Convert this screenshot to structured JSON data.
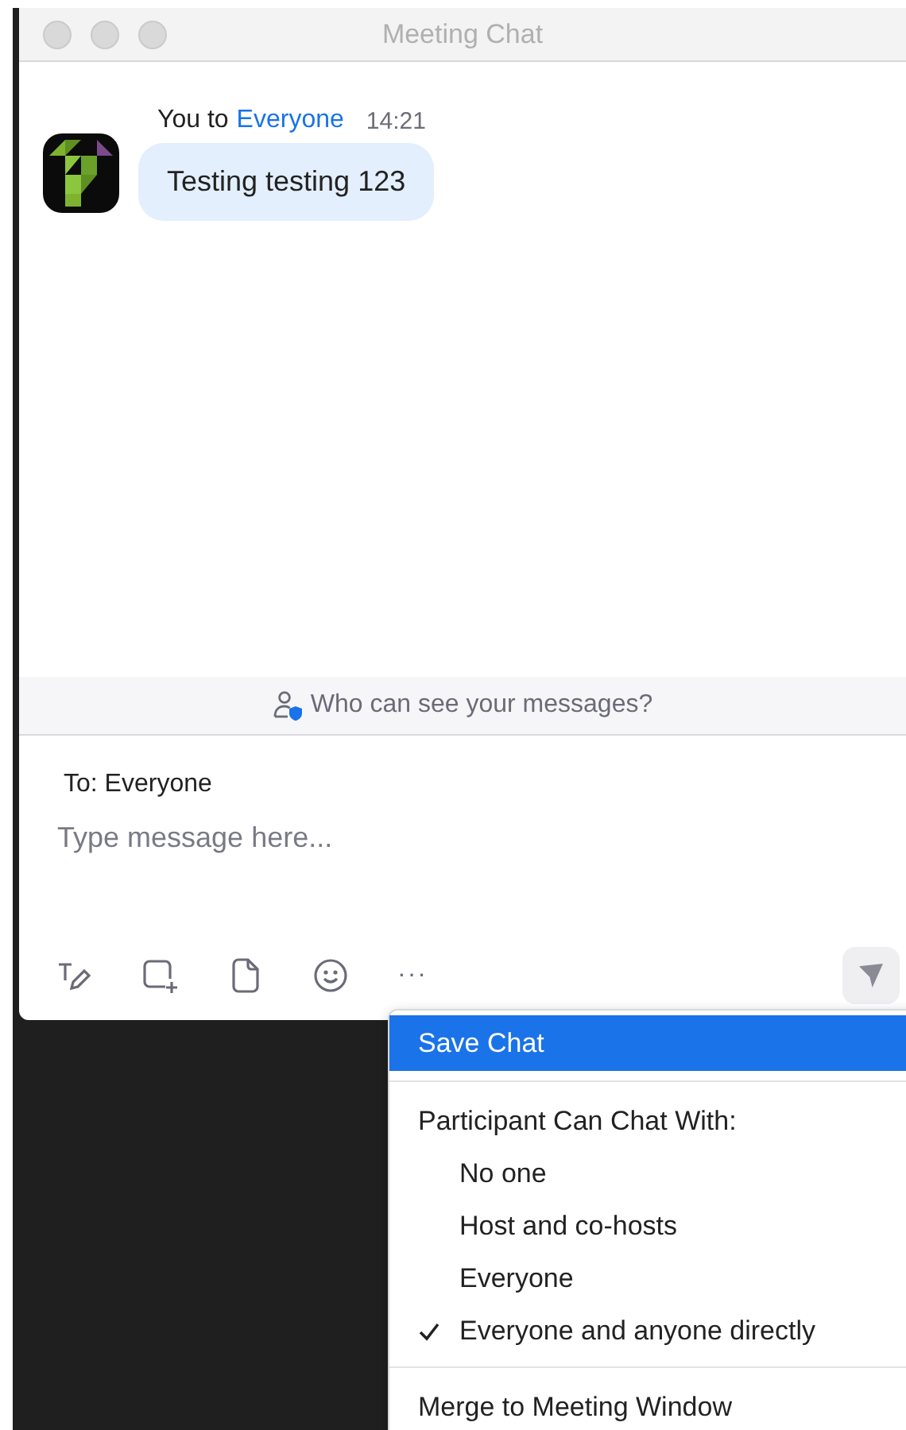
{
  "window": {
    "title": "Meeting Chat"
  },
  "message": {
    "sender": "You to",
    "recipient": "Everyone",
    "time": "14:21",
    "text": "Testing testing 123"
  },
  "privacy_banner": {
    "text": "Who can see your messages?"
  },
  "composer": {
    "to_label": "To: Everyone",
    "placeholder": "Type message here..."
  },
  "toolbar": {
    "more_label": "···"
  },
  "menu": {
    "items": [
      {
        "kind": "action",
        "label": "Save Chat",
        "selected": true
      },
      {
        "kind": "divider"
      },
      {
        "kind": "header",
        "label": "Participant Can Chat With:"
      },
      {
        "kind": "option",
        "label": "No one",
        "checked": false
      },
      {
        "kind": "option",
        "label": "Host and co-hosts",
        "checked": false
      },
      {
        "kind": "option",
        "label": "Everyone",
        "checked": false
      },
      {
        "kind": "option",
        "label": "Everyone and anyone directly",
        "checked": true
      },
      {
        "kind": "divider"
      },
      {
        "kind": "action",
        "label": "Merge to Meeting Window",
        "selected": false
      }
    ]
  }
}
